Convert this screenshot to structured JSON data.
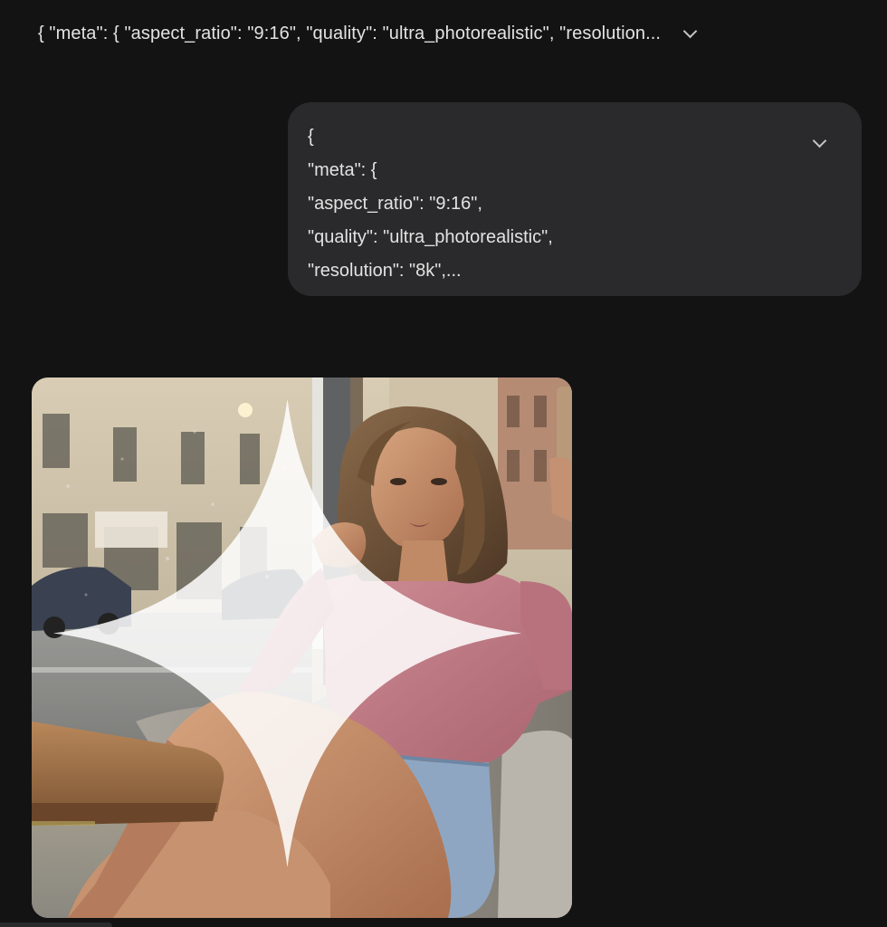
{
  "prompt_header": {
    "text": "{ \"meta\": { \"aspect_ratio\": \"9:16\", \"quality\": \"ultra_photorealistic\", \"resolution...",
    "icon": "chevron-down-icon"
  },
  "user_bubble": {
    "lines": [
      "{",
      "\"meta\": {",
      "\"aspect_ratio\": \"9:16\",",
      "\"quality\": \"ultra_photorealistic\",",
      "\"resolution\": \"8k\",..."
    ],
    "expand_icon": "chevron-down-icon"
  },
  "generated_image": {
    "sparkle_icon": "sparkle-icon"
  },
  "colors": {
    "background": "#131314",
    "bubble": "#2a2a2c",
    "text": "#e3e3e3",
    "sweater": "#c27f8a",
    "denim": "#8fa6c2"
  }
}
